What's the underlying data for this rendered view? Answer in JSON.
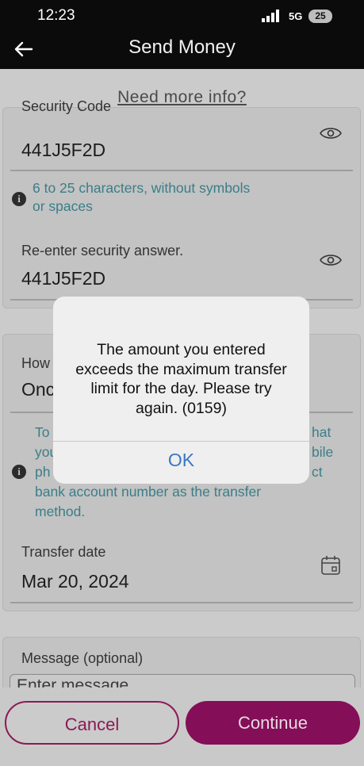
{
  "status_bar": {
    "time": "12:23",
    "network": "5G",
    "battery": "25"
  },
  "app_bar": {
    "title": "Send Money"
  },
  "info_link": "Need more info?",
  "security": {
    "code_label": "Security Code",
    "code_value": "441J5F2D",
    "hint_line1": "6 to 25 characters, without symbols",
    "hint_line2": "or spaces",
    "reenter_label": "Re-enter security answer.",
    "reenter_value": "441J5F2D"
  },
  "transfer": {
    "how_label": "How",
    "how_value": "Onc",
    "hint_left": [
      "To",
      "you",
      "ph",
      "bank account number as the transfer",
      "method."
    ],
    "hint_right": [
      "hat",
      "bile",
      "ct"
    ],
    "date_label": "Transfer date",
    "date_value": "Mar 20, 2024"
  },
  "message": {
    "label": "Message (optional)",
    "placeholder": "Enter message"
  },
  "buttons": {
    "cancel": "Cancel",
    "continue": "Continue"
  },
  "dialog": {
    "message": "The amount you entered exceeds the maximum transfer limit for the day. Please try again. (0159)",
    "ok": "OK"
  },
  "colors": {
    "accent": "#840e57",
    "hint": "#3a7e88",
    "dialog_button": "#3b77c4"
  }
}
